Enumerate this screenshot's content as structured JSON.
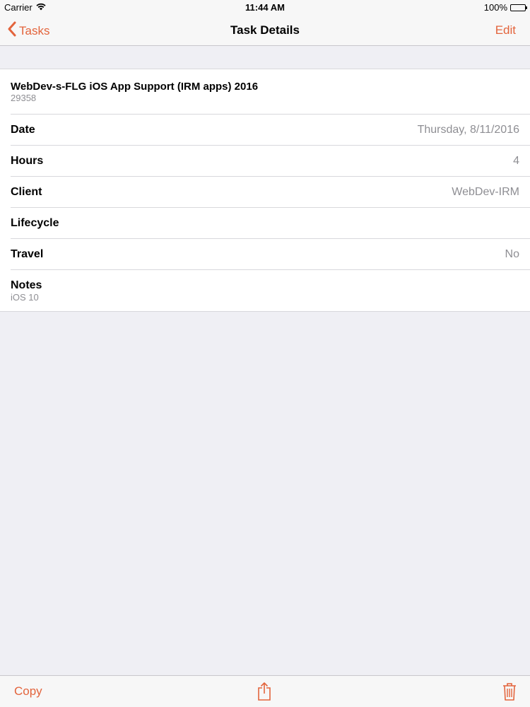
{
  "status_bar": {
    "carrier": "Carrier",
    "time": "11:44 AM",
    "battery": "100%",
    "battery_level": 1.0,
    "icons": [
      "wifi-icon",
      "battery-icon"
    ]
  },
  "nav": {
    "back_label": "Tasks",
    "title": "Task Details",
    "edit_label": "Edit",
    "icons": [
      "chevron-left-icon"
    ]
  },
  "task": {
    "title": "WebDev-s-FLG iOS App Support (IRM apps) 2016",
    "id": "29358"
  },
  "details": {
    "date": {
      "label": "Date",
      "value": "Thursday, 8/11/2016"
    },
    "hours": {
      "label": "Hours",
      "value": "4"
    },
    "client": {
      "label": "Client",
      "value": "WebDev-IRM"
    },
    "lifecycle": {
      "label": "Lifecycle",
      "value": ""
    },
    "travel": {
      "label": "Travel",
      "value": "No"
    },
    "notes": {
      "label": "Notes",
      "value": "iOS 10"
    }
  },
  "toolbar": {
    "copy_label": "Copy",
    "icons": [
      "share-icon",
      "trash-icon"
    ]
  },
  "colors": {
    "accent": "#e3643c",
    "background": "#efeff4",
    "secondary_text": "#8e8e93"
  }
}
